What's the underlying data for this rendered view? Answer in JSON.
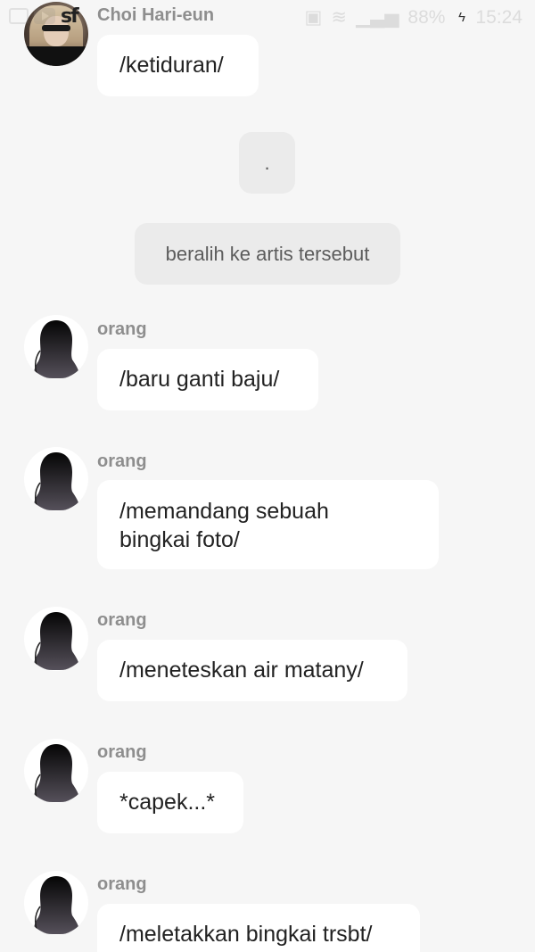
{
  "status_bar": {
    "watermark": "sf",
    "battery": "88%",
    "time": "15:24"
  },
  "messages": [
    {
      "type": "incoming",
      "avatar": "photo",
      "sender": "Choi Hari-eun",
      "text": "/ketiduran/"
    },
    {
      "type": "system",
      "text": "."
    },
    {
      "type": "system",
      "text": "beralih ke artis tersebut"
    },
    {
      "type": "incoming",
      "avatar": "silhouette",
      "sender": "orang",
      "text": "/baru ganti baju/"
    },
    {
      "type": "incoming",
      "avatar": "silhouette",
      "sender": "orang",
      "text_lines": [
        "/memandang sebuah",
        "bingkai foto/"
      ]
    },
    {
      "type": "incoming",
      "avatar": "silhouette",
      "sender": "orang",
      "text": "/meneteskan air matany/"
    },
    {
      "type": "incoming",
      "avatar": "silhouette",
      "sender": "orang",
      "text": "*capek...*"
    },
    {
      "type": "incoming",
      "avatar": "silhouette",
      "sender": "orang",
      "text": "/meletakkan bingkai trsbt/"
    }
  ],
  "colors": {
    "background": "#f6f6f6",
    "bubble": "#ffffff",
    "system_bubble": "#ebebeb",
    "sender_name": "#8e8e8e"
  },
  "icons": [
    "gallery-icon",
    "youtube-icon",
    "sf-app-icon",
    "sim-icon",
    "wifi-icon",
    "signal-icon",
    "charging-icon"
  ]
}
